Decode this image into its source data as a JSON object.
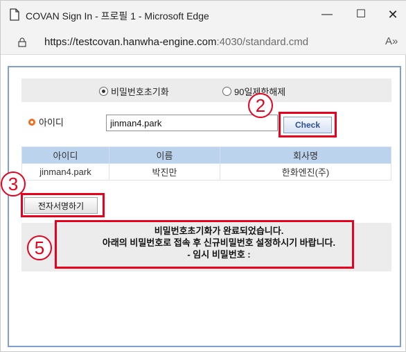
{
  "window": {
    "title": "COVAN Sign In - 프로필 1 - Microsoft Edge",
    "minimize_glyph": "—",
    "maximize_glyph": "☐",
    "close_glyph": "✕"
  },
  "address": {
    "url_host": "https://testcovan.hanwha-engine.com",
    "url_rest": ":4030/standard.cmd",
    "reader_glyph": "A»"
  },
  "form": {
    "radio_options": [
      {
        "label": "비밀번호초기화",
        "selected": true
      },
      {
        "label": "90일제한해제",
        "selected": false
      }
    ],
    "id_label": "아이디",
    "id_value": "jinman4.park",
    "check_button": "Check",
    "sign_button": "전자서명하기"
  },
  "table": {
    "headers": [
      "아이디",
      "이름",
      "회사명"
    ],
    "rows": [
      [
        "jinman4.park",
        "박진만",
        "한화엔진(주)"
      ]
    ]
  },
  "message": {
    "line1": "비밀번호초기화가 완료되었습니다.",
    "line2": "아래의 비밀번호로 접속 후 신규비밀번호 설정하시기 바랍니다.",
    "line3": "- 임시 비밀번호 :"
  },
  "annotations": {
    "step_2": "2",
    "step_3": "3",
    "step_5": "5",
    "highlight_color": "#e8001c"
  },
  "colors": {
    "accent_orange": "#f26a1b",
    "frame_border": "#7e9fd1",
    "table_header": "#bcd3ee"
  }
}
